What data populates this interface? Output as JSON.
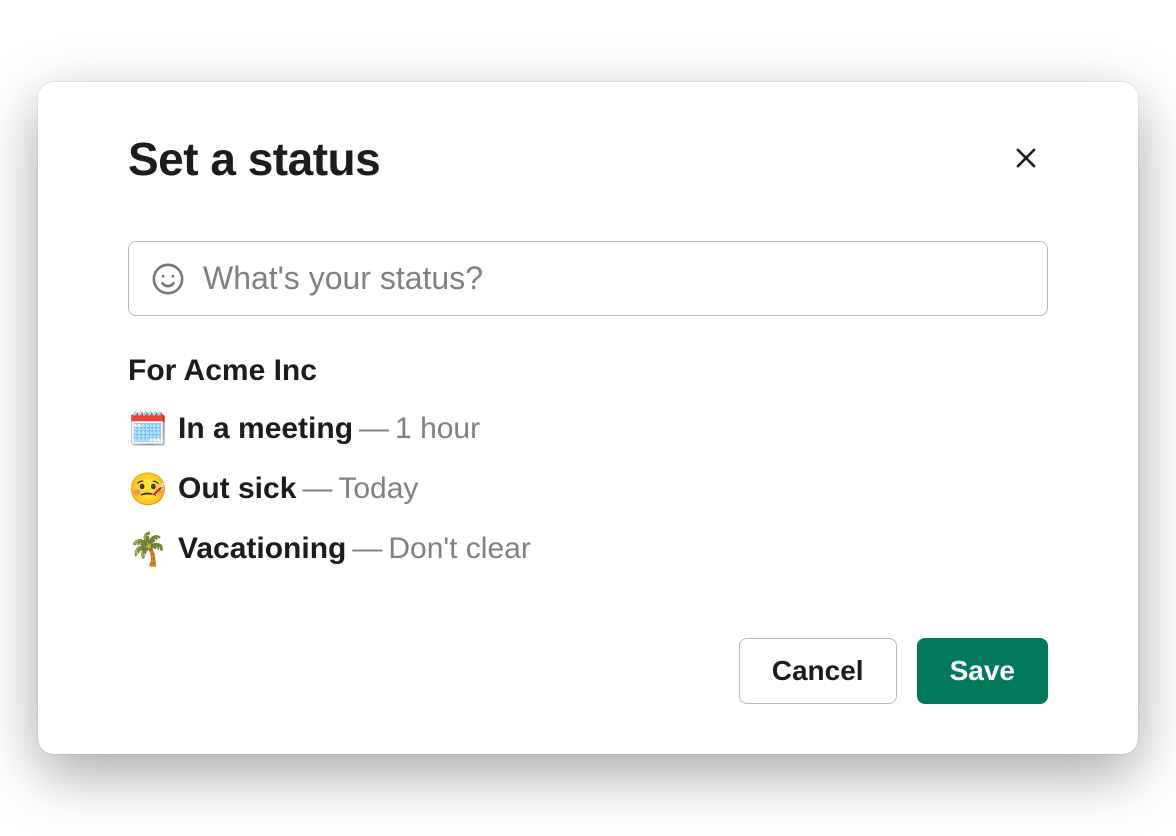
{
  "modal": {
    "title": "Set a status",
    "input": {
      "placeholder": "What's your status?",
      "value": ""
    },
    "workspace_label": "For Acme Inc",
    "presets": [
      {
        "emoji": "🗓️",
        "label": "In a meeting",
        "separator": "—",
        "duration": "1 hour"
      },
      {
        "emoji": "🤒",
        "label": "Out sick",
        "separator": "—",
        "duration": "Today"
      },
      {
        "emoji": "🌴",
        "label": "Vacationing",
        "separator": "—",
        "duration": "Don't clear"
      }
    ],
    "buttons": {
      "cancel": "Cancel",
      "save": "Save"
    }
  }
}
